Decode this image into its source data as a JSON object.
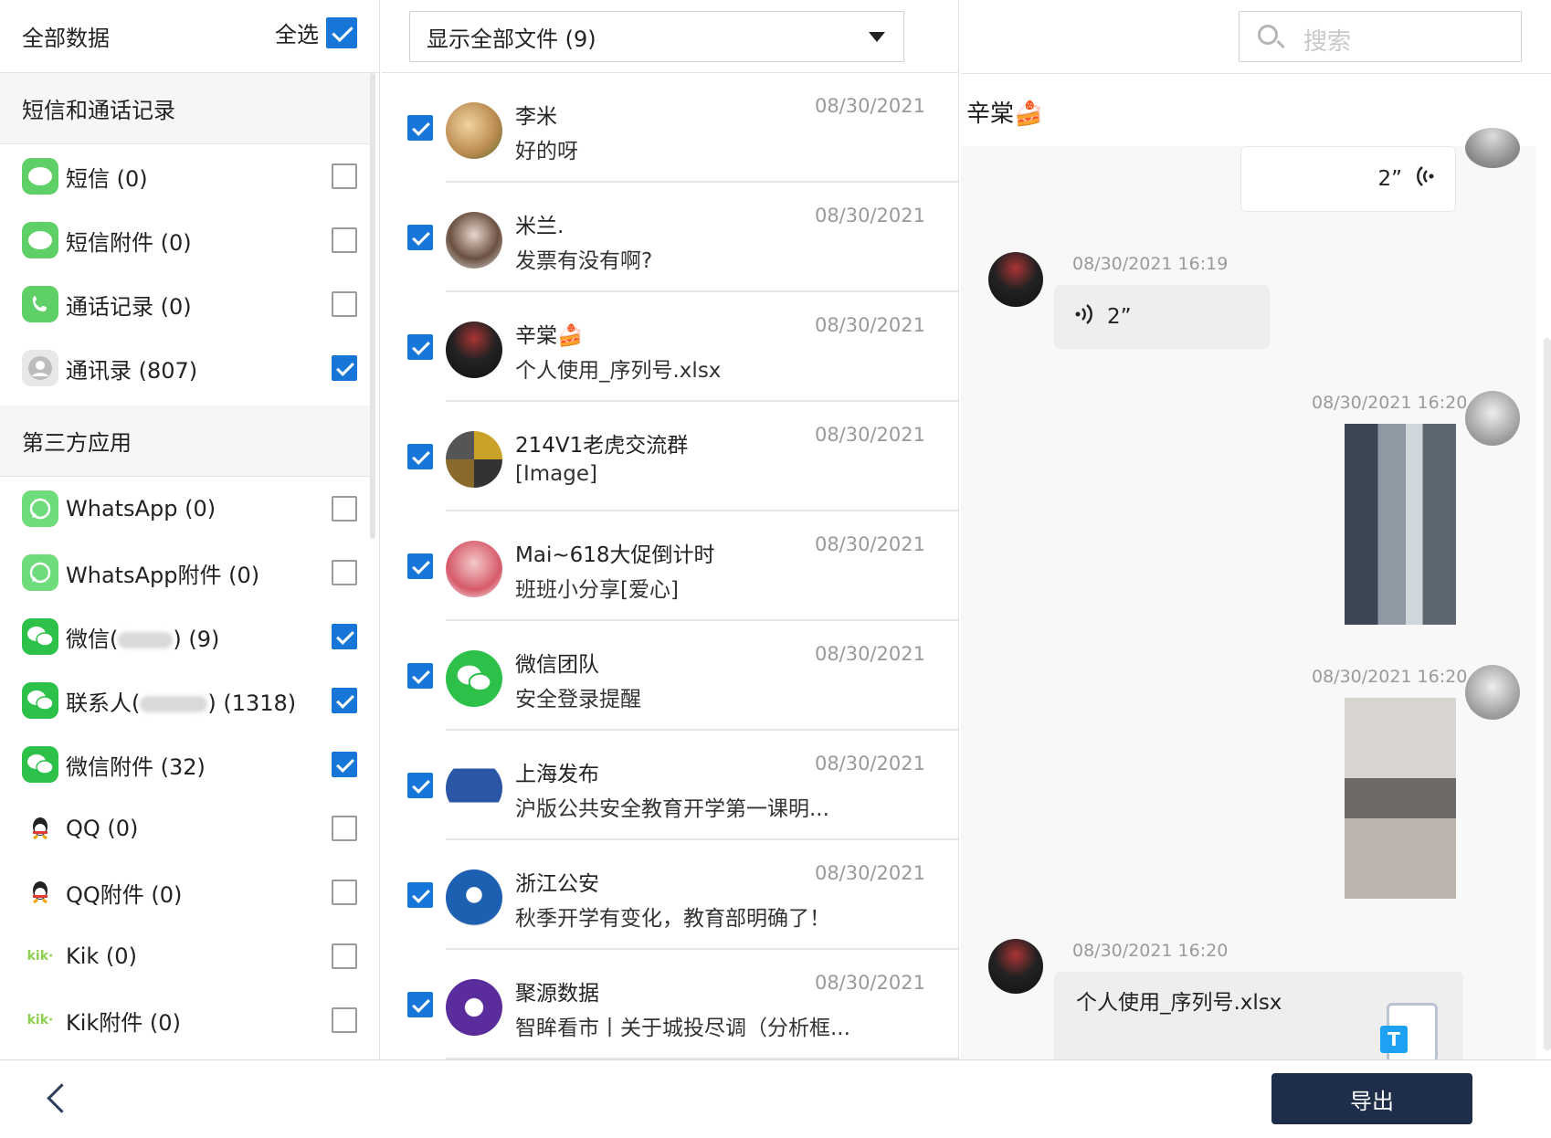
{
  "left": {
    "title": "全部数据",
    "select_all_label": "全选",
    "section_sms": "短信和通话记录",
    "section_third": "第三方应用",
    "items": [
      {
        "label": "短信 (0)",
        "checked": false,
        "icon": "sms-icon"
      },
      {
        "label": "短信附件 (0)",
        "checked": false,
        "icon": "sms-icon"
      },
      {
        "label": "通话记录 (0)",
        "checked": false,
        "icon": "phone-icon"
      },
      {
        "label": "通讯录 (807)",
        "checked": true,
        "icon": "contacts-icon"
      },
      {
        "label": "WhatsApp (0)",
        "checked": false,
        "icon": "whatsapp-icon"
      },
      {
        "label": "WhatsApp附件 (0)",
        "checked": false,
        "icon": "whatsapp-icon"
      },
      {
        "label_a": "微信(",
        "label_b": ") (9)",
        "checked": true,
        "icon": "wechat-icon"
      },
      {
        "label_a": "联系人(",
        "label_b": ") (1318)",
        "checked": true,
        "icon": "wechat-icon"
      },
      {
        "label": "微信附件 (32)",
        "checked": true,
        "icon": "wechat-icon"
      },
      {
        "label": "QQ (0)",
        "checked": false,
        "icon": "qq-icon"
      },
      {
        "label": "QQ附件 (0)",
        "checked": false,
        "icon": "qq-icon"
      },
      {
        "label": "Kik (0)",
        "checked": false,
        "icon": "kik-icon"
      },
      {
        "label": "Kik附件 (0)",
        "checked": false,
        "icon": "kik-icon"
      }
    ],
    "kik_icon_text": "kik·"
  },
  "middle": {
    "filter_label": "显示全部文件 (9)",
    "messages": [
      {
        "name": "李米",
        "preview": "好的呀",
        "date": "08/30/2021"
      },
      {
        "name": "米兰.",
        "preview": "发票有没有啊?",
        "date": "08/30/2021"
      },
      {
        "name": "辛棠🍰",
        "preview": "个人使用_序列号.xlsx",
        "date": "08/30/2021"
      },
      {
        "name": "214V1老虎交流群",
        "preview": "[Image]",
        "date": "08/30/2021"
      },
      {
        "name": "Mai~618大促倒计时",
        "preview": "班班小分享[爱心]",
        "date": "08/30/2021"
      },
      {
        "name": "微信团队",
        "preview": "安全登录提醒",
        "date": "08/30/2021"
      },
      {
        "name": "上海发布",
        "preview": "沪版公共安全教育开学第一课明...",
        "date": "08/30/2021"
      },
      {
        "name": "浙江公安",
        "preview": "秋季开学有变化，教育部明确了！",
        "date": "08/30/2021"
      },
      {
        "name": "聚源数据",
        "preview": "智眸看市丨关于城投尽调（分析框...",
        "date": "08/30/2021"
      }
    ]
  },
  "right": {
    "search_placeholder": "搜索",
    "chat_title": "辛棠🍰",
    "voice_top": "2”",
    "time1": "08/30/2021 16:19",
    "voice_left": "2”",
    "time2": "08/30/2021 16:20",
    "time3": "08/30/2021 16:20",
    "time4": "08/30/2021 16:20",
    "file_name": "个人使用_序列号.xlsx",
    "file_badge": "T"
  },
  "bottom": {
    "export_label": "导出"
  },
  "colors": {
    "accent": "#1677d8",
    "export_bg": "#1e2d4a",
    "wechat_green": "#2dc14a"
  }
}
